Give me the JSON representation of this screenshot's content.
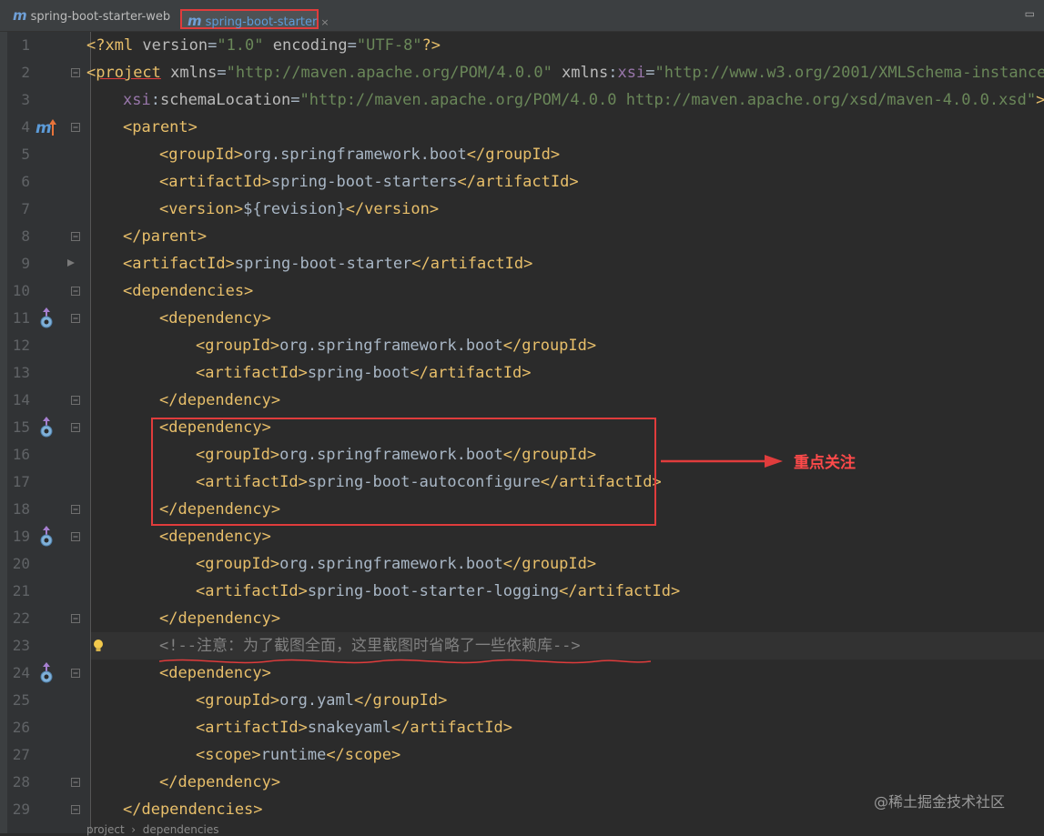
{
  "tabs": [
    {
      "label": "spring-boot-starter-web",
      "icon": "maven-icon"
    },
    {
      "label": "spring-boot-starter",
      "icon": "maven-icon",
      "active": true,
      "close": "×"
    }
  ],
  "top_right_icon": "▭",
  "editor": {
    "lines": [
      {
        "n": "1"
      },
      {
        "n": "2"
      },
      {
        "n": "3"
      },
      {
        "n": "4"
      },
      {
        "n": "5"
      },
      {
        "n": "6"
      },
      {
        "n": "7"
      },
      {
        "n": "8"
      },
      {
        "n": "9"
      },
      {
        "n": "10"
      },
      {
        "n": "11"
      },
      {
        "n": "12"
      },
      {
        "n": "13"
      },
      {
        "n": "14"
      },
      {
        "n": "15"
      },
      {
        "n": "16"
      },
      {
        "n": "17"
      },
      {
        "n": "18"
      },
      {
        "n": "19"
      },
      {
        "n": "20"
      },
      {
        "n": "21"
      },
      {
        "n": "22"
      },
      {
        "n": "23"
      },
      {
        "n": "24"
      },
      {
        "n": "25"
      },
      {
        "n": "26"
      },
      {
        "n": "27"
      },
      {
        "n": "28"
      },
      {
        "n": "29"
      }
    ],
    "code": {
      "l1": {
        "open": "<?xml ",
        "a1": "version",
        "eq1": "=",
        "v1": "\"1.0\"",
        "a2": " encoding",
        "eq2": "=",
        "v2": "\"UTF-8\"",
        "close": "?>"
      },
      "l2": {
        "open": "<",
        "tag": "project",
        "a1": " xmlns",
        "eq1": "=",
        "v1": "\"http://maven.apache.org/POM/4.0.0\"",
        "a2": " xmlns",
        "colon": ":",
        "ns": "xsi",
        "eq2": "=",
        "v2": "\"http://www.w3.org/2001/XMLSchema-instance\""
      },
      "l3": {
        "ns": "xsi",
        "colon": ":",
        "a1": "schemaLocation",
        "eq1": "=",
        "v1": "\"http://maven.apache.org/POM/4.0.0 http://maven.apache.org/xsd/maven-4.0.0.xsd\"",
        "close": ">"
      },
      "l4": {
        "t": "<parent>"
      },
      "l5": {
        "o": "<groupId>",
        "x": "org.springframework.boot",
        "c": "</groupId>"
      },
      "l6": {
        "o": "<artifactId>",
        "x": "spring-boot-starters",
        "c": "</artifactId>"
      },
      "l7": {
        "o": "<version>",
        "x": "${revision}",
        "c": "</version>"
      },
      "l8": {
        "t": "</parent>"
      },
      "l9": {
        "o": "<artifactId>",
        "x": "spring-boot-starter",
        "c": "</artifactId>"
      },
      "l10": {
        "t": "<dependencies>"
      },
      "l11": {
        "t": "<dependency>"
      },
      "l12": {
        "o": "<groupId>",
        "x": "org.springframework.boot",
        "c": "</groupId>"
      },
      "l13": {
        "o": "<artifactId>",
        "x": "spring-boot",
        "c": "</artifactId>"
      },
      "l14": {
        "t": "</dependency>"
      },
      "l15": {
        "t": "<dependency>"
      },
      "l16": {
        "o": "<groupId>",
        "x": "org.springframework.boot",
        "c": "</groupId>"
      },
      "l17": {
        "o": "<artifactId>",
        "x": "spring-boot-autoconfigure",
        "c": "</artifactId>"
      },
      "l18": {
        "t": "</dependency>"
      },
      "l19": {
        "t": "<dependency>"
      },
      "l20": {
        "o": "<groupId>",
        "x": "org.springframework.boot",
        "c": "</groupId>"
      },
      "l21": {
        "o": "<artifactId>",
        "x": "spring-boot-starter-logging",
        "c": "</artifactId>"
      },
      "l22": {
        "t": "</dependency>"
      },
      "l23": {
        "comment": "<!--注意：为了截图全面，这里截图时省略了一些依赖库-->"
      },
      "l24": {
        "t": "<dependency>"
      },
      "l25": {
        "o": "<groupId>",
        "x": "org.yaml",
        "c": "</groupId>"
      },
      "l26": {
        "o": "<artifactId>",
        "x": "snakeyaml",
        "c": "</artifactId>"
      },
      "l27": {
        "o": "<scope>",
        "x": "runtime",
        "c": "</scope>"
      },
      "l28": {
        "t": "</dependency>"
      },
      "l29": {
        "t": "</dependencies>"
      }
    }
  },
  "annotation": {
    "label": "重点关注",
    "color": "#e03c3c"
  },
  "watermark": "@稀土掘金技术社区",
  "breadcrumb": "project  ›  dependencies",
  "colors": {
    "tag": "#e8bf6a",
    "attr": "#bababa",
    "value": "#6a8759",
    "namespace": "#9876aa",
    "text": "#a9b7c6",
    "comment": "#808080",
    "background": "#2b2b2b"
  }
}
